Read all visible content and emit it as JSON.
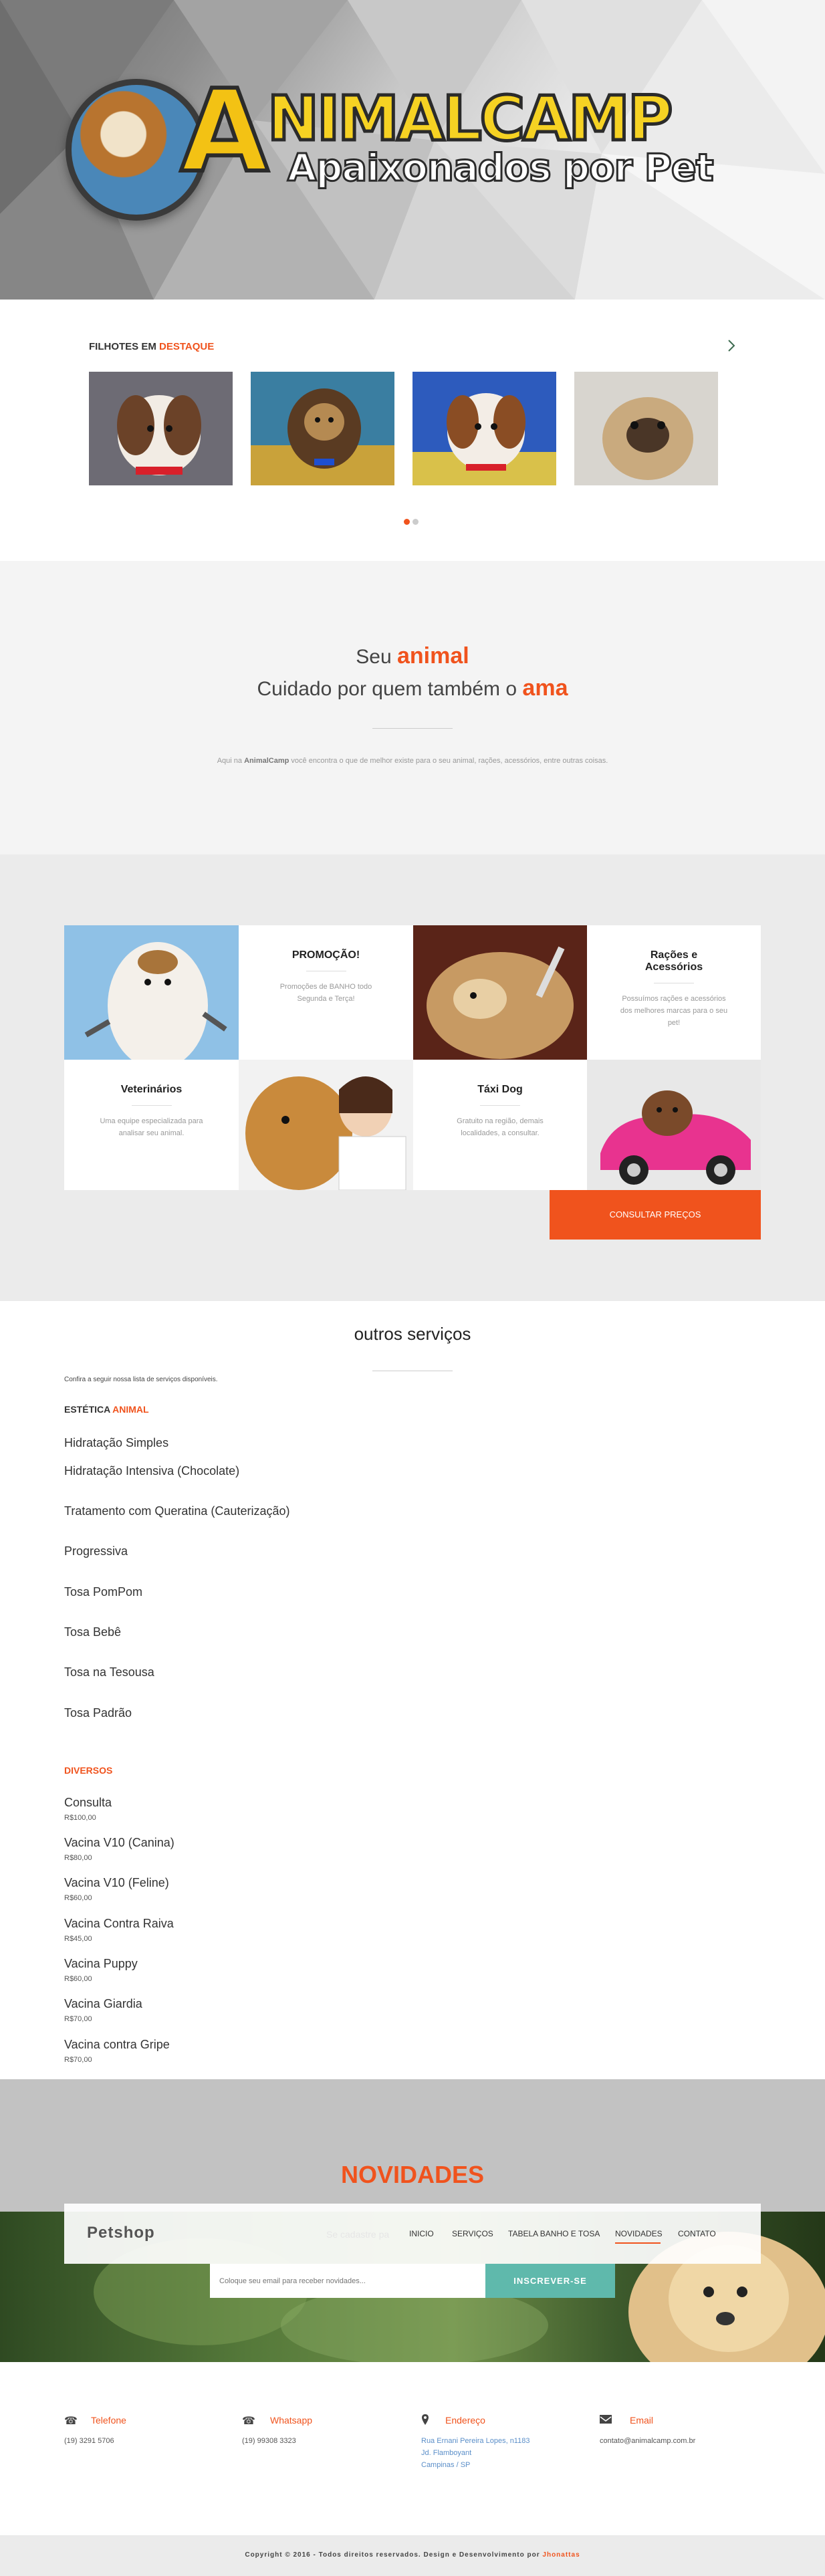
{
  "hero": {
    "brand": "NIMALCAMP",
    "brand_initial": "A",
    "tagline": "Apaixonados por Pet",
    "logo_badge": "Animal Camp"
  },
  "destaques": {
    "title_plain": "FILHOTES EM",
    "title_accent": "DESTAQUE",
    "next_icon": "chevron-right"
  },
  "intro": {
    "line1_plain": "Seu",
    "line1_accent": "animal",
    "line2_plain": "Cuidado por quem também o",
    "line2_accent": "ama",
    "desc_before": "Aqui na",
    "desc_brand": "AnimalCamp",
    "desc_after": "você encontra o que de melhor existe para o seu animal, rações, acessórios, entre outras coisas."
  },
  "services": {
    "promo_title": "PROMOÇÃO!",
    "promo_text": "Promoções de BANHO todo Segunda e Terça!",
    "racoes_title": "Rações e Acessórios",
    "racoes_text": "Possuímos rações e acessórios dos melhores marcas para o seu pet!",
    "vet_title": "Veterinários",
    "vet_text": "Uma equipe especializada para analisar seu animal.",
    "taxi_title": "Táxi Dog",
    "taxi_text": "Gratuito na região, demais localidades, a consultar.",
    "cta": "CONSULTAR PREÇOS"
  },
  "outros": {
    "title": "outros serviços",
    "intro": "Confira a seguir nossa lista de serviços disponíveis.",
    "estetica_plain": "ESTÉTICA",
    "estetica_accent": "ANIMAL",
    "estetica_items": [
      "Hidratação Simples",
      "Hidratação Intensiva (Chocolate)",
      "Tratamento com Queratina (Cauterização)",
      "Progressiva",
      "Tosa PomPom",
      "Tosa Bebê",
      "Tosa na Tesousa",
      "Tosa Padrão"
    ],
    "diversos_title": "DIVERSOS",
    "diversos_items": [
      {
        "name": "Consulta",
        "price": "R$100,00"
      },
      {
        "name": "Vacina V10 (Canina)",
        "price": "R$80,00"
      },
      {
        "name": "Vacina V10 (Feline)",
        "price": "R$60,00"
      },
      {
        "name": "Vacina Contra Raiva",
        "price": "R$45,00"
      },
      {
        "name": "Vacina Puppy",
        "price": "R$60,00"
      },
      {
        "name": "Vacina Giardia",
        "price": "R$70,00"
      },
      {
        "name": "Vacina contra Gripe",
        "price": "R$70,00"
      }
    ]
  },
  "novidades": {
    "title": "NOVIDADES",
    "logo": "Petshop",
    "ghost": "Se cadastre pa",
    "nav": [
      "INICIO",
      "SERVIÇOS",
      "TABELA BANHO E TOSA",
      "NOVIDADES",
      "CONTATO"
    ],
    "input_placeholder": "Coloque seu email para receber novidades...",
    "subscribe": "INSCREVER-SE"
  },
  "footer": {
    "tel_label": "Telefone",
    "tel_value": "(19) 3291 5706",
    "whats_label": "Whatsapp",
    "whats_value": "(19) 99308 3323",
    "end_label": "Endereço",
    "end_l1": "Rua Ernani Pereira Lopes, n1183",
    "end_l2": "Jd. Flamboyant",
    "end_l3": "Campinas / SP",
    "email_label": "Email",
    "email_value": "contato@animalcamp.com.br",
    "copyright": "Copyright © 2016 - Todos direitos reservados. Design e Desenvolvimento por",
    "dev": "Jhonattas"
  },
  "colors": {
    "accent": "#f0531d",
    "teal": "#5fb9ac"
  }
}
